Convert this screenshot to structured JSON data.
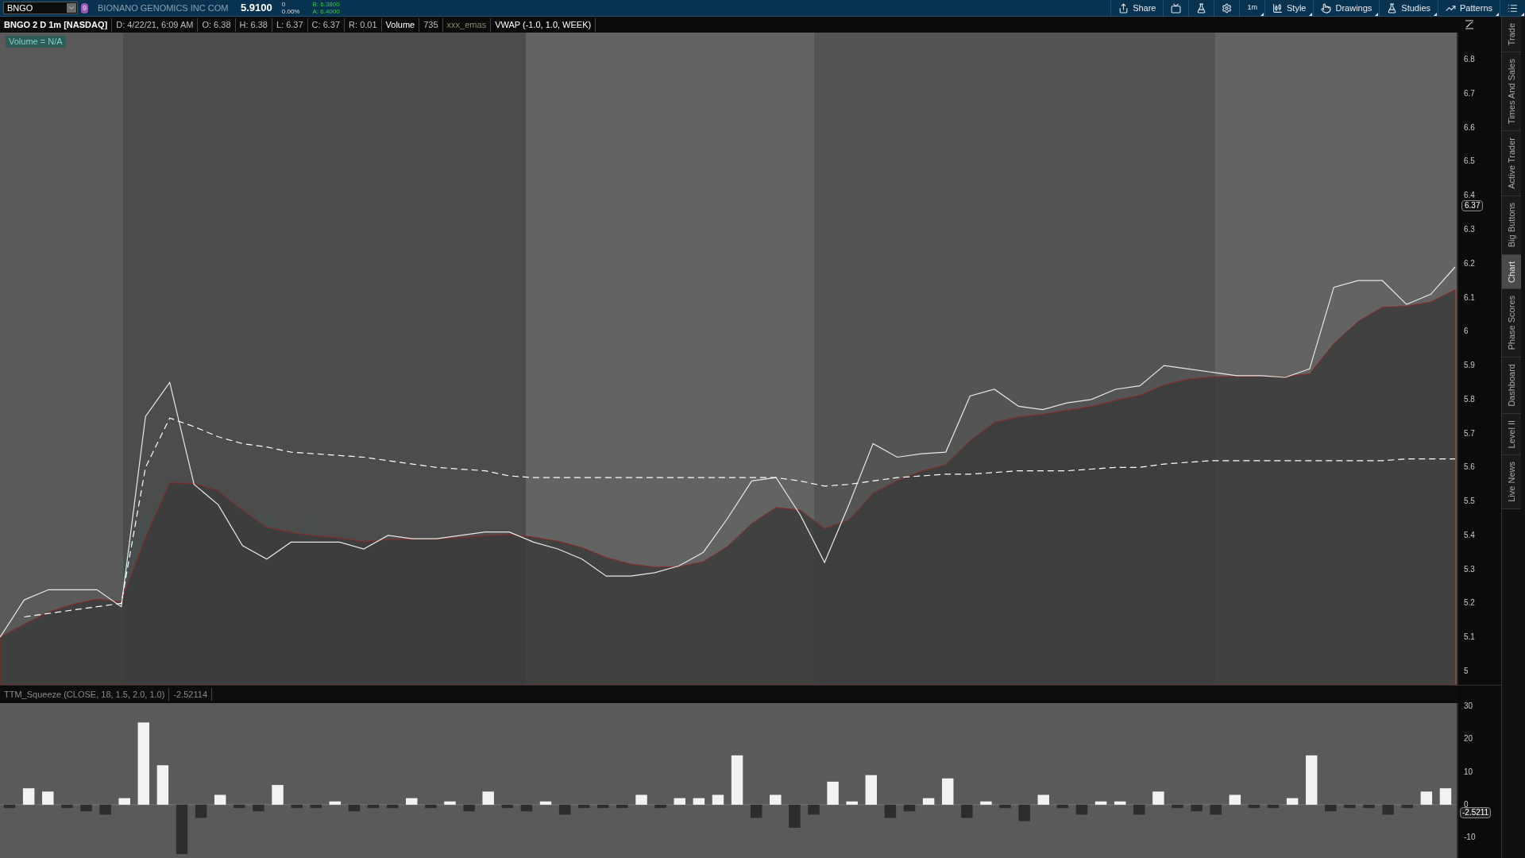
{
  "top_bar": {
    "symbol": "BNGO",
    "link_group": "9",
    "company": "BIONANO GENOMICS INC COM",
    "last": "5.9100",
    "change": "0",
    "change_pct": "0.00%",
    "bid": "B: 6.3800",
    "ask": "A: 6.4000",
    "tools": [
      {
        "kind": "share",
        "label": "Share",
        "menu": false
      },
      {
        "kind": "alert",
        "menu": false
      },
      {
        "kind": "flask",
        "menu": false
      },
      {
        "kind": "gear",
        "menu": false
      },
      {
        "kind": "text",
        "label": "1m",
        "menu": true
      },
      {
        "kind": "style",
        "label": "Style",
        "menu": true
      },
      {
        "kind": "drawings",
        "label": "Drawings",
        "menu": true
      },
      {
        "kind": "studies",
        "label": "Studies",
        "menu": true
      },
      {
        "kind": "patterns",
        "label": "Patterns",
        "menu": true
      },
      {
        "kind": "menu",
        "menu": true
      }
    ]
  },
  "legend": {
    "title": "BNGO 2 D 1m [NASDAQ]",
    "items": [
      {
        "text": "D: 4/22/21, 6:09 AM",
        "kind": "plain"
      },
      {
        "text": "O: 6.38",
        "kind": "plain"
      },
      {
        "text": "H: 6.38",
        "kind": "plain"
      },
      {
        "text": "L: 6.37",
        "kind": "plain"
      },
      {
        "text": "C: 6.37",
        "kind": "plain"
      },
      {
        "text": "R: 0.01",
        "kind": "plain"
      },
      {
        "text": "Volume",
        "kind": "bright"
      },
      {
        "text": "735",
        "kind": "plain"
      },
      {
        "text": "xxx_emas",
        "kind": "dim"
      },
      {
        "text": "VWAP (-1.0, 1.0, WEEK)",
        "kind": "bright"
      }
    ]
  },
  "price_chart": {
    "volume_label": "Volume = N/A",
    "price_badge": "6.37",
    "chart_data": {
      "type": "line",
      "ylim": [
        4.96,
        6.88
      ],
      "yticks": [
        5,
        5.1,
        5.2,
        5.3,
        5.4,
        5.5,
        5.6,
        5.7,
        5.8,
        5.9,
        6,
        6.1,
        6.2,
        6.3,
        6.4,
        6.5,
        6.6,
        6.7,
        6.8
      ],
      "series": [
        {
          "color": "#e8e8e8",
          "values": [
            5.1,
            5.21,
            5.24,
            5.24,
            5.24,
            5.19,
            5.75,
            5.85,
            5.55,
            5.49,
            5.37,
            5.33,
            5.38,
            5.38,
            5.38,
            5.36,
            5.4,
            5.39,
            5.39,
            5.4,
            5.41,
            5.41,
            5.38,
            5.36,
            5.33,
            5.28,
            5.28,
            5.29,
            5.31,
            5.35,
            5.45,
            5.56,
            5.57,
            5.46,
            5.32,
            5.49,
            5.67,
            5.63,
            5.64,
            5.645,
            5.81,
            5.83,
            5.78,
            5.77,
            5.79,
            5.8,
            5.83,
            5.84,
            5.9,
            5.89,
            5.88,
            5.87,
            5.87,
            5.865,
            5.89,
            6.13,
            6.15,
            6.15,
            6.08,
            6.11,
            6.19
          ]
        },
        {
          "color": "#ffffff",
          "line_style": "dashed",
          "values": [
            null,
            5.16,
            5.17,
            5.18,
            5.19,
            5.2,
            5.6,
            5.745,
            5.72,
            5.69,
            5.67,
            5.66,
            5.645,
            5.64,
            5.635,
            5.63,
            5.62,
            5.61,
            5.6,
            5.595,
            5.59,
            5.575,
            5.57,
            5.57,
            5.57,
            5.57,
            5.57,
            5.57,
            5.57,
            5.57,
            5.57,
            5.57,
            5.57,
            5.56,
            5.545,
            5.55,
            5.56,
            5.57,
            5.575,
            5.58,
            5.58,
            5.585,
            5.59,
            5.59,
            5.59,
            5.595,
            5.6,
            5.6,
            5.61,
            5.615,
            5.62,
            5.62,
            5.62,
            5.62,
            5.62,
            5.62,
            5.62,
            5.62,
            5.625,
            5.625,
            5.625
          ]
        }
      ]
    }
  },
  "indicator": {
    "title": "TTM_Squeeze (CLOSE, 18, 1.5, 2.0, 1.0)",
    "reading": "-2.52114",
    "badge": "-2.5211",
    "chart_data": {
      "type": "bar",
      "ylim": [
        -16.2,
        30.9
      ],
      "yticks": [
        -10,
        0,
        10,
        20,
        30
      ],
      "values": [
        -1,
        5,
        4,
        -1,
        -2,
        -3,
        2,
        25,
        12,
        -15,
        -4,
        3,
        -1,
        -2,
        6,
        -1,
        -1,
        1,
        -2,
        -1,
        -1,
        2,
        -1,
        1,
        -2,
        4,
        -1,
        -2,
        1,
        -3,
        -1,
        -1,
        -1,
        3,
        -1,
        2,
        2,
        3,
        15,
        -4,
        3,
        -7,
        -3,
        7,
        1,
        9,
        -4,
        -2,
        2,
        8,
        -4,
        1,
        -1,
        -5,
        3,
        -1,
        -3,
        1,
        1,
        -3,
        4,
        -1,
        -2,
        -3,
        3,
        -1,
        -1,
        2,
        15,
        -2,
        -1,
        -1,
        -3,
        -1,
        4,
        5
      ]
    }
  },
  "side_tabs": [
    {
      "label": "Trade",
      "selected": false
    },
    {
      "label": "Times And Sales",
      "selected": false
    },
    {
      "label": "Active Trader",
      "selected": false
    },
    {
      "label": "Big Buttons",
      "selected": false
    },
    {
      "label": "Chart",
      "selected": true
    },
    {
      "label": "Phase Scores",
      "selected": false
    },
    {
      "label": "Dashboard",
      "selected": false
    },
    {
      "label": "Level II",
      "selected": false
    },
    {
      "label": "Live News",
      "selected": false
    }
  ]
}
